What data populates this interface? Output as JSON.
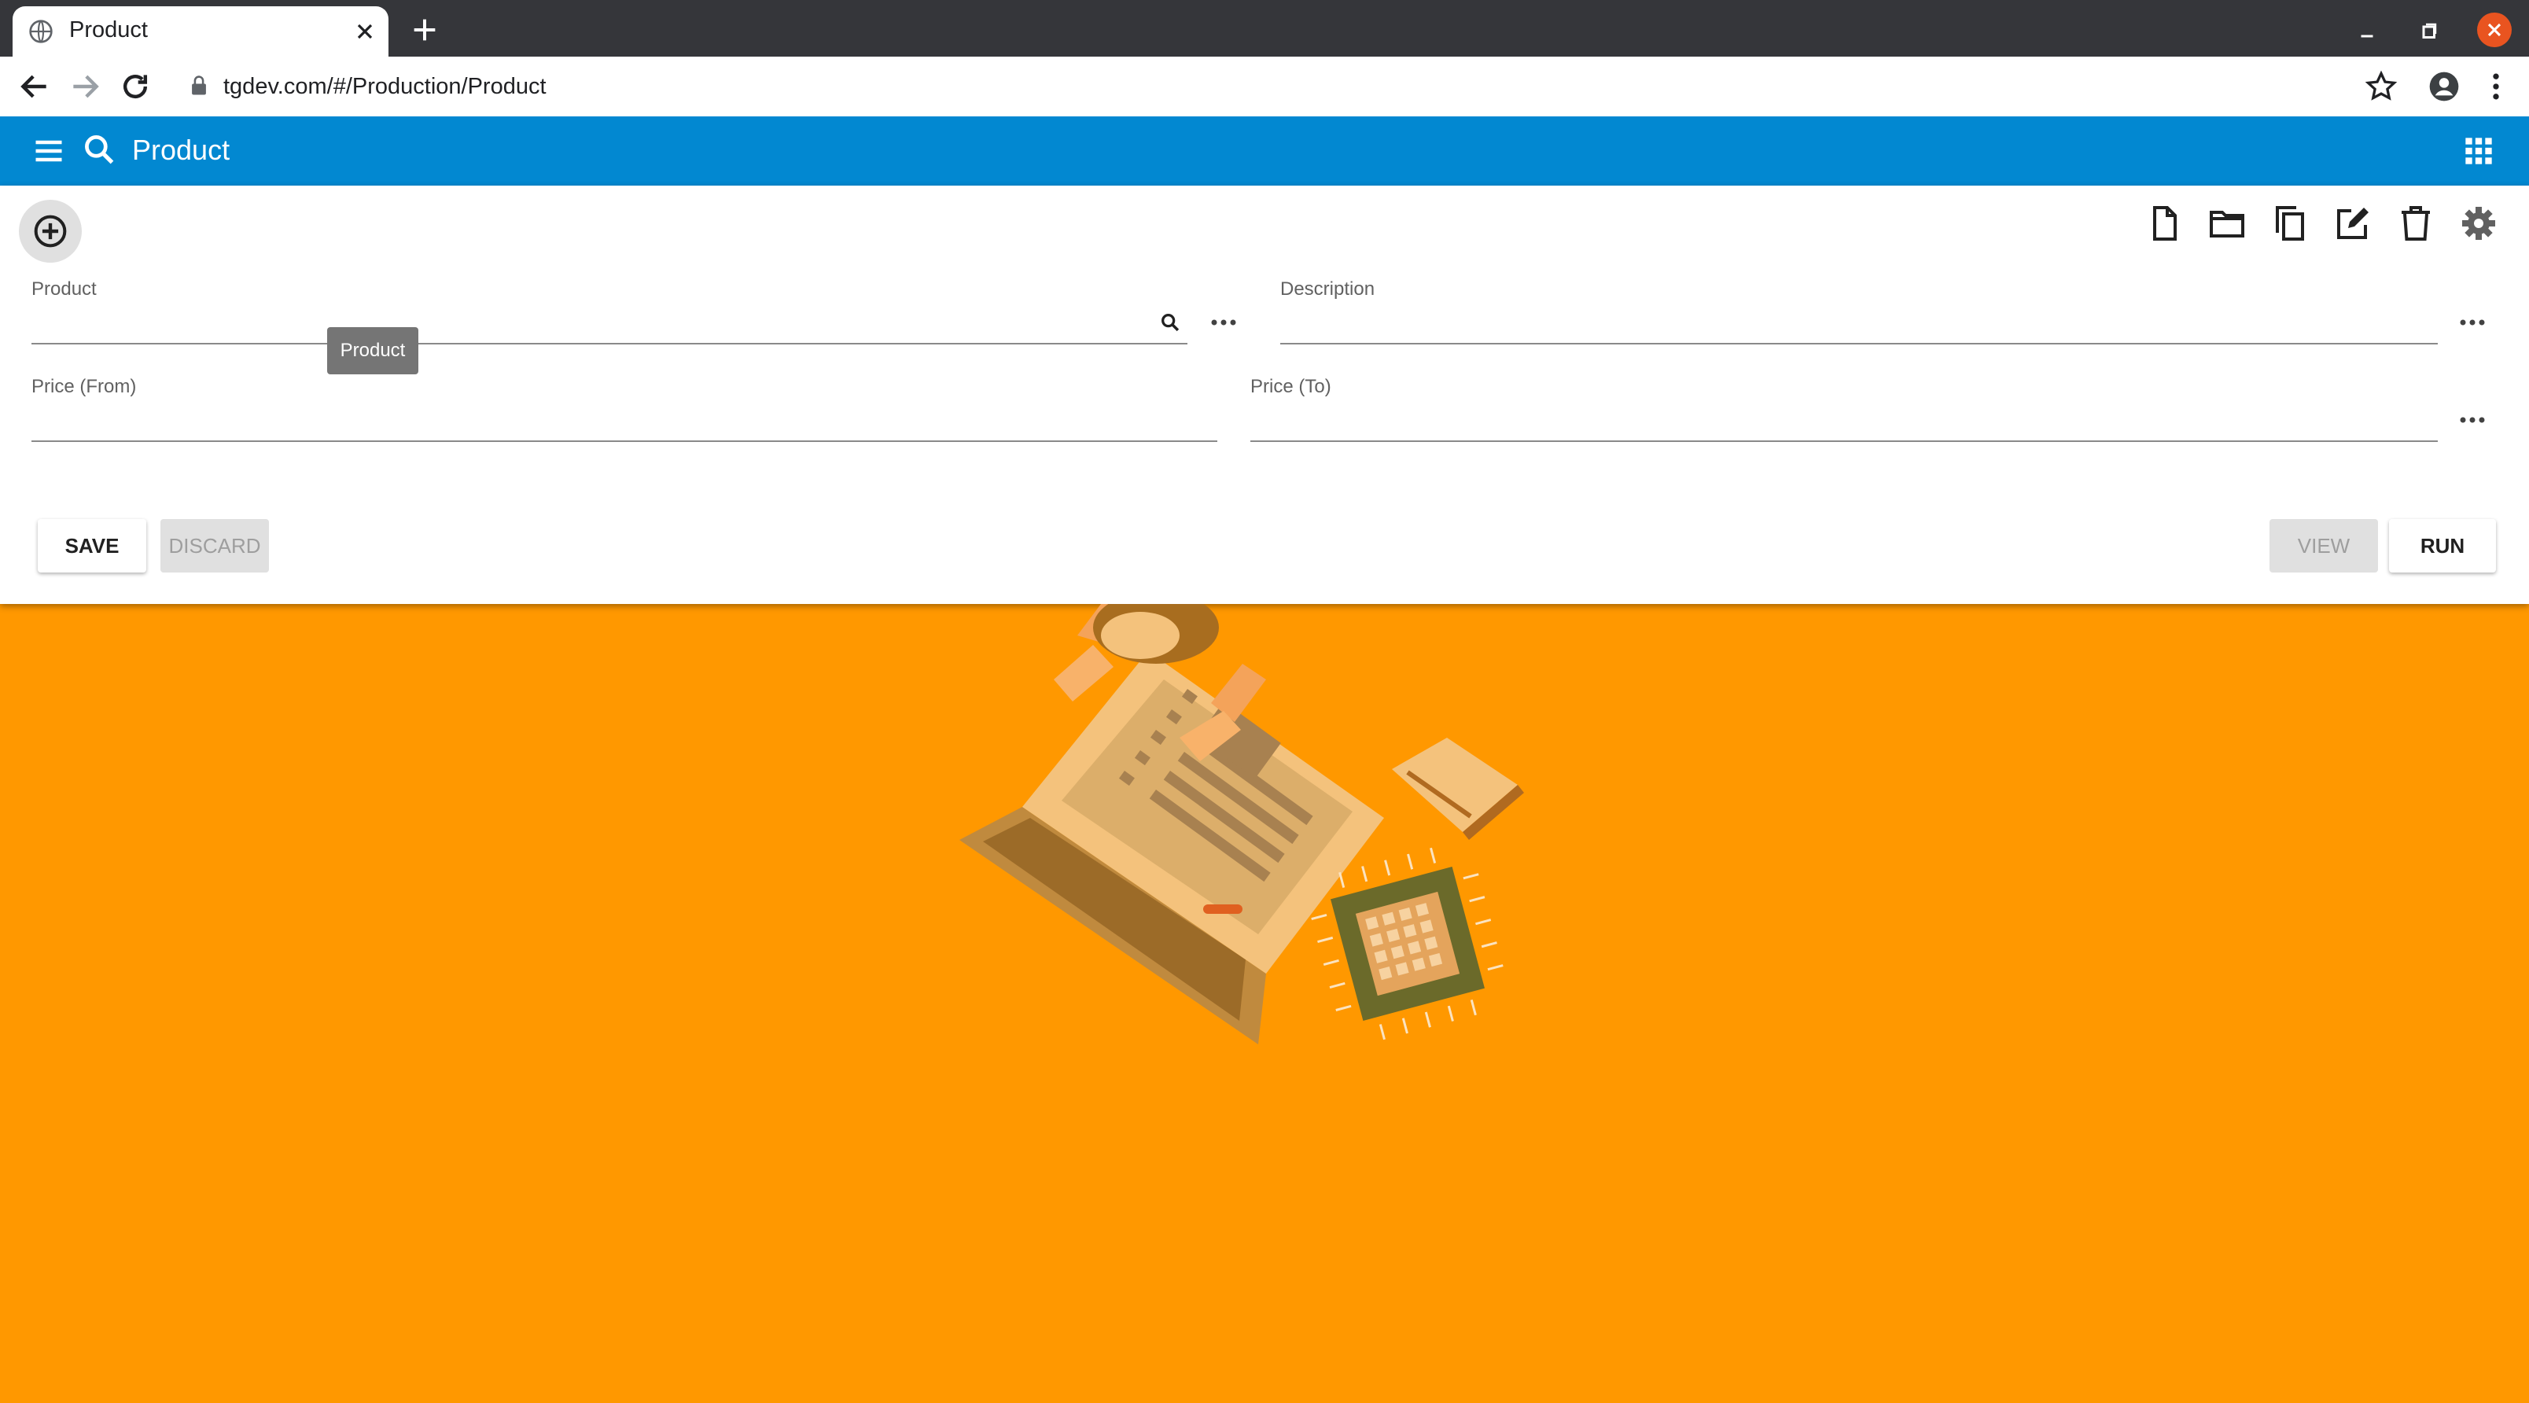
{
  "browser": {
    "tab_title": "Product",
    "url": "tgdev.com/#/Production/Product"
  },
  "appbar": {
    "title": "Product"
  },
  "form": {
    "fields": {
      "product": {
        "label": "Product",
        "value": ""
      },
      "description": {
        "label": "Description",
        "value": ""
      },
      "price_from": {
        "label": "Price (From)",
        "value": ""
      },
      "price_to": {
        "label": "Price (To)",
        "value": ""
      }
    },
    "tooltip": "Product"
  },
  "actions": {
    "save": "SAVE",
    "discard": "DISCARD",
    "view": "VIEW",
    "run": "RUN"
  },
  "colors": {
    "appbar": "#0288d1",
    "background": "#ff9800",
    "close_button": "#e95420"
  },
  "icons": [
    "globe-icon",
    "close-icon",
    "plus-icon",
    "back-arrow-icon",
    "forward-arrow-icon",
    "reload-icon",
    "lock-icon",
    "star-icon",
    "account-icon",
    "kebab-icon",
    "hamburger-icon",
    "search-icon",
    "apps-grid-icon",
    "add-circle-icon",
    "new-document-icon",
    "open-folder-icon",
    "copy-icon",
    "edit-icon",
    "delete-icon",
    "settings-gear-icon",
    "more-horiz-icon"
  ]
}
